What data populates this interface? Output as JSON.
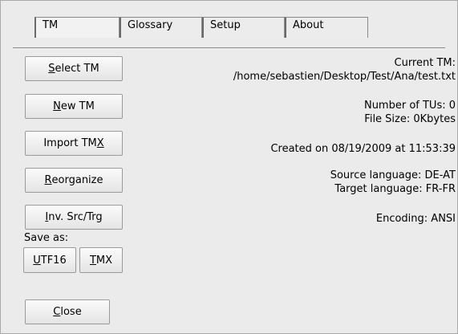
{
  "tabs": [
    {
      "label": "TM"
    },
    {
      "label": "Glossary"
    },
    {
      "label": "Setup"
    },
    {
      "label": "About"
    }
  ],
  "buttons": {
    "select_tm": {
      "mnemonic": "S",
      "rest": "elect TM"
    },
    "new_tm": {
      "mnemonic": "N",
      "rest": "ew TM"
    },
    "import_tmx": {
      "pre": "Import TM",
      "mnemonic": "X"
    },
    "reorganize": {
      "mnemonic": "R",
      "rest": "eorganize"
    },
    "inv_src_trg": {
      "mnemonic": "I",
      "rest": "nv. Src/Trg"
    },
    "utf16": {
      "mnemonic": "U",
      "rest": "TF16"
    },
    "tmx": {
      "mnemonic": "T",
      "rest": "MX"
    },
    "close": {
      "mnemonic": "C",
      "rest": "lose"
    }
  },
  "save_as_label": "Save as:",
  "info": {
    "current_tm_label": "Current TM:",
    "current_tm_path": "/home/sebastien/Desktop/Test/Ana/test.txt",
    "num_tus": "Number of TUs: 0",
    "file_size": "File Size: 0Kbytes",
    "created": "Created on 08/19/2009 at 11:53:39",
    "source_lang": "Source language: DE-AT",
    "target_lang": "Target language: FR-FR",
    "encoding": "Encoding: ANSI"
  }
}
